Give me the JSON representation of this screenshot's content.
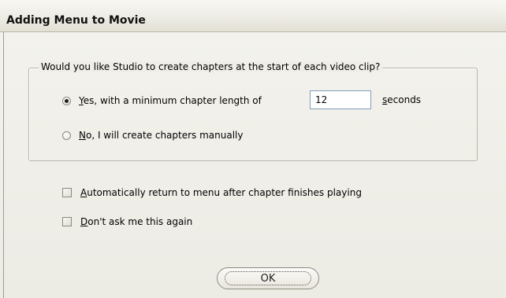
{
  "dialog": {
    "title": "Adding Menu to Movie"
  },
  "chapters_group": {
    "legend": "Would you like Studio to create chapters at the start of each video clip?",
    "options": [
      {
        "accel": "Y",
        "label_rest": "es, with a minimum chapter length of",
        "checked": true
      },
      {
        "accel": "N",
        "label_rest": "o, I will create chapters manually",
        "checked": false
      }
    ],
    "min_length": {
      "value": "12",
      "unit_accel": "s",
      "unit_rest": "econds"
    }
  },
  "checkboxes": [
    {
      "accel": "A",
      "label_rest": "utomatically return to menu after chapter finishes playing",
      "checked": false
    },
    {
      "accel": "D",
      "label_rest": "on't ask me this again",
      "checked": false
    }
  ],
  "ok_button": {
    "label": "OK"
  }
}
